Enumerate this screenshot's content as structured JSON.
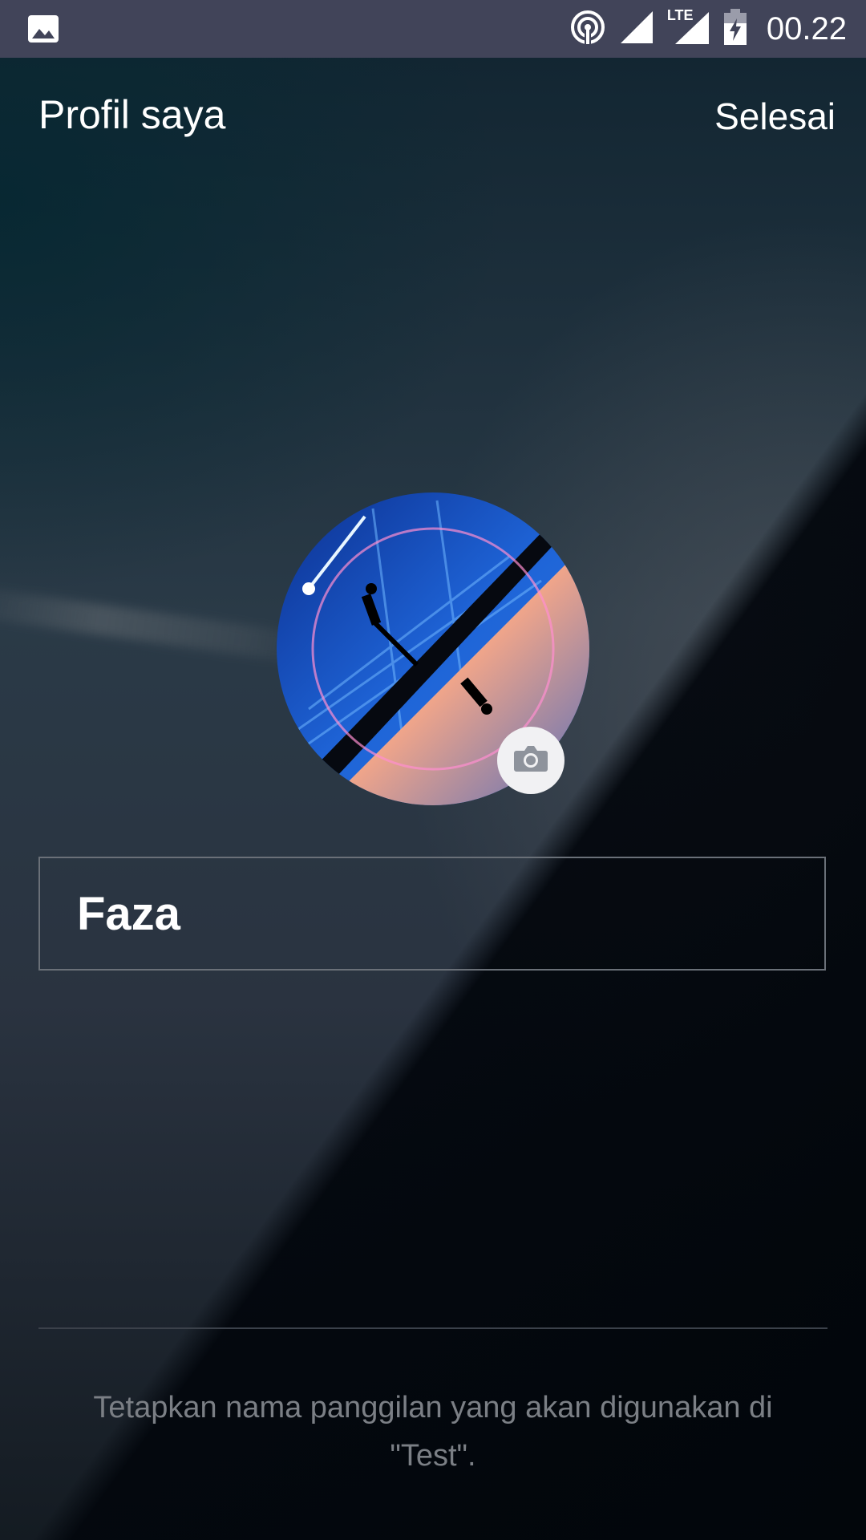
{
  "status_bar": {
    "left_icon": "image-icon",
    "icons": [
      "hotspot-icon",
      "signal-icon",
      "lte-signal-icon",
      "battery-charging-icon"
    ],
    "lte_label": "LTE",
    "time": "00.22"
  },
  "header": {
    "title": "Profil saya",
    "done_label": "Selesai"
  },
  "profile": {
    "avatar": "profile-photo",
    "camera_icon": "camera-icon",
    "name_value": "Faza"
  },
  "footer": {
    "hint": "Tetapkan nama panggilan yang akan digunakan di \"Test\"."
  }
}
